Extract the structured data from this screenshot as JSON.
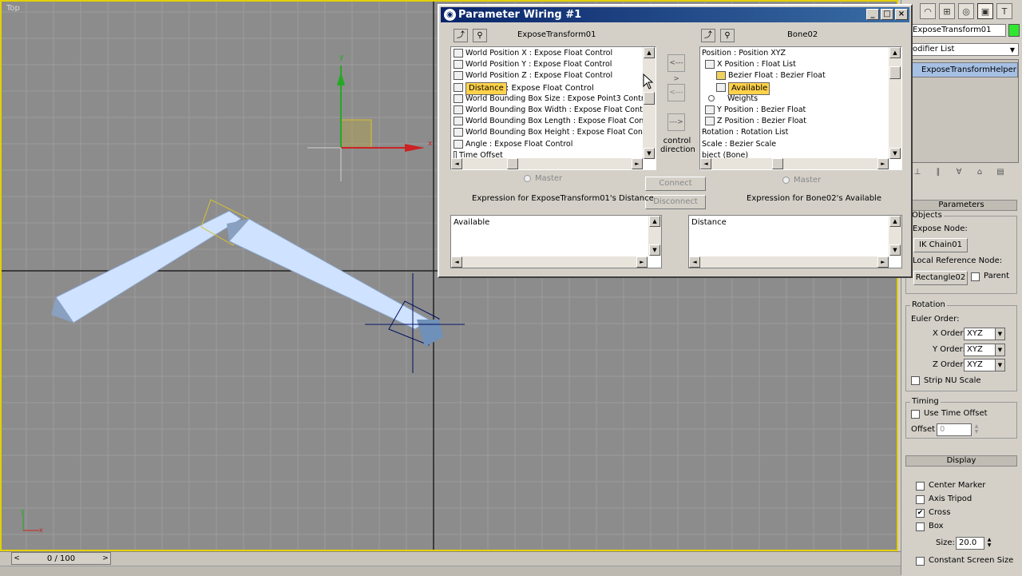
{
  "viewport": {
    "label": "Top",
    "axis_labels": {
      "y": "y",
      "x": "x"
    }
  },
  "timeline": {
    "value": "0 / 100",
    "prev": "<",
    "next": ">"
  },
  "dialog": {
    "title": "Parameter Wiring #1",
    "left_pane": {
      "title": "ExposeTransform01",
      "items": [
        "World Position X : Expose Float Control",
        "World Position Y : Expose Float Control",
        "World Position Z : Expose Float Control",
        "Distance : Expose Float Control",
        "World Bounding Box Size : Expose Point3 Contro",
        "World Bounding Box Width : Expose Float Contro",
        "World Bounding Box Length : Expose Float Cont",
        "World Bounding Box Height : Expose Float Contr",
        "Angle : Expose Float Control",
        "Time Offset"
      ],
      "selected_index": 3,
      "master_label": "Master",
      "expression_label": "Expression for ExposeTransform01's Distance",
      "expression_text": "Available"
    },
    "right_pane": {
      "title": "Bone02",
      "items": [
        "Position : Position XYZ",
        "X Position : Float List",
        "Bezier Float : Bezier Float",
        "Available",
        "Weights",
        "Y Position : Bezier Float",
        "Z Position : Bezier Float",
        "Rotation : Rotation List",
        "Scale : Bezier Scale",
        "bject (Bone)"
      ],
      "selected_index": 3,
      "master_label": "Master",
      "expression_label": "Expression for Bone02's Available",
      "expression_text": "Distance"
    },
    "direction_buttons": {
      "both": "<--->",
      "left": "<---",
      "right": "--->"
    },
    "control_direction_label": "control direction",
    "connect_label": "Connect",
    "disconnect_label": "Disconnect"
  },
  "command_panel": {
    "object_name": "ExposeTransform01",
    "object_color": "#2ee82e",
    "modifier_list": "odifier List",
    "stack_item": "ExposeTransformHelper",
    "parameters_title": "Parameters",
    "objects_group": "Objects",
    "expose_node_label": "Expose Node:",
    "expose_node_value": "IK Chain01",
    "local_ref_label": "Local Reference Node:",
    "local_ref_value": "Rectangle02",
    "parent_label": "Parent",
    "rotation_group": "Rotation",
    "euler_label": "Euler Order:",
    "x_order_label": "X Order:",
    "y_order_label": "Y Order:",
    "z_order_label": "Z Order:",
    "x_order": "XYZ",
    "y_order": "XYZ",
    "z_order": "XYZ",
    "strip_nu_label": "Strip NU Scale",
    "timing_group": "Timing",
    "use_time_offset_label": "Use Time Offset",
    "offset_label": "Offset",
    "offset_value": "0",
    "display_title": "Display",
    "center_marker_label": "Center Marker",
    "axis_tripod_label": "Axis Tripod",
    "cross_label": "Cross",
    "box_label": "Box",
    "size_label": "Size:",
    "size_value": "20.0",
    "constant_label": "Constant Screen Size",
    "cross_checked": "✔"
  }
}
